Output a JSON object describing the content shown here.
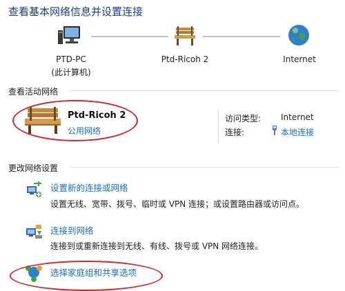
{
  "header": {
    "title": "查看基本网络信息并设置连接"
  },
  "network_map": {
    "nodes": [
      {
        "line1": "PTD-PC",
        "line2": "(此计算机)",
        "icon": "computer-icon"
      },
      {
        "line1": "Ptd-Ricoh  2",
        "line2": "",
        "icon": "bench-network-icon"
      },
      {
        "line1": "Internet",
        "line2": "",
        "icon": "globe-icon"
      }
    ]
  },
  "active_networks": {
    "heading": "查看活动网络",
    "network_name": "Ptd-Ricoh  2",
    "network_type": "公用网络",
    "access_type_label": "访问类型:",
    "access_type_value": "Internet",
    "connection_label": "连接:",
    "connection_value": "本地连接"
  },
  "change_settings": {
    "heading": "更改网络设置",
    "tasks": [
      {
        "link": "设置新的连接或网络",
        "desc": "设置无线、宽带、拨号、临时或 VPN 连接；或设置路由器或访问点。",
        "icon": "new-connection-icon"
      },
      {
        "link": "连接到网络",
        "desc": "连接到或重新连接到无线、有线、拨号或 VPN 网络连接。",
        "icon": "connect-network-icon"
      },
      {
        "link": "选择家庭组和共享选项",
        "desc": "",
        "icon": "homegroup-icon"
      }
    ]
  },
  "annotation_color": "#d8232a",
  "link_color": "#1a6fc9"
}
